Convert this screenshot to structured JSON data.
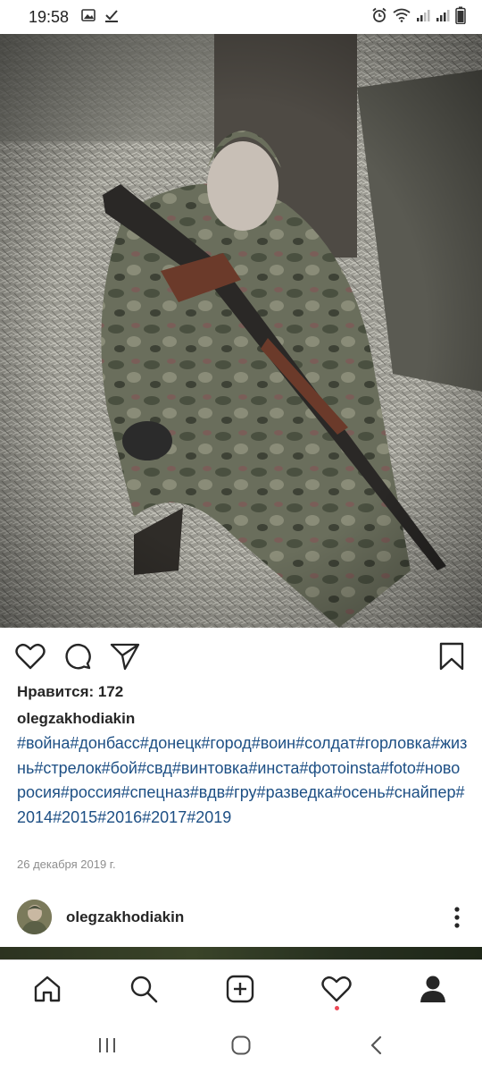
{
  "status_bar": {
    "time": "19:58",
    "left_icons": [
      "gallery-icon",
      "download-done-icon"
    ],
    "right_icons": [
      "alarm-icon",
      "wifi-icon",
      "signal-icon",
      "signal-icon",
      "battery-icon"
    ]
  },
  "post": {
    "likes_label": "Нравится:",
    "likes_count": "172",
    "username": "olegzakhodiakin",
    "hashtags": "#война#донбасс#донецк#город#воин#солдат#горловка#жизнь#стрелок#бой#свд#винтовка#инста#фотоinsta#foto#новоросия#россия#спецназ#вдв#гру#разведка#осень#снайпер#2014#2015#2016#2017#2019",
    "date": "26 декабря 2019 г.",
    "action_icons": [
      "heart-icon",
      "comment-icon",
      "share-icon",
      "bookmark-icon"
    ]
  },
  "next_post": {
    "username": "olegzakhodiakin"
  },
  "bottom_nav": {
    "items": [
      "home-icon",
      "search-icon",
      "add-post-icon",
      "activity-heart-icon",
      "profile-icon"
    ]
  },
  "system_nav": {
    "items": [
      "recent-apps-icon",
      "home-button-icon",
      "back-icon"
    ]
  },
  "colors": {
    "hashtag": "#1d4f84",
    "text": "#262626",
    "secondary": "#8e8e8e",
    "notification_dot": "#ed4956"
  }
}
